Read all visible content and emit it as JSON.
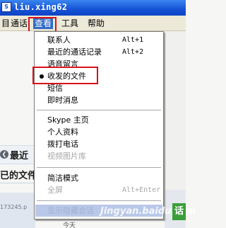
{
  "window": {
    "title": "liu.xing62"
  },
  "menubar": {
    "items": [
      "目",
      "通话",
      "查看",
      "工具",
      "帮助"
    ],
    "active_index": 2
  },
  "background": {
    "back_icon": "back-arrow-icon",
    "recent_heading": "最近",
    "files_heading": "已的文件",
    "contact_id": "173245.p",
    "date_label": "今天"
  },
  "view_menu": {
    "items": [
      {
        "label": "联系人",
        "shortcut": "Alt+1",
        "state": "normal"
      },
      {
        "label": "最近的通话记录",
        "shortcut": "Alt+2",
        "state": "normal"
      },
      {
        "label": "语音留言",
        "shortcut": "",
        "state": "normal"
      },
      {
        "label": "收发的文件",
        "shortcut": "",
        "state": "checked"
      },
      {
        "label": "短信",
        "shortcut": "",
        "state": "normal"
      },
      {
        "label": "即时消息",
        "shortcut": "",
        "state": "normal"
      },
      {
        "label": "Skype 主页",
        "shortcut": "",
        "state": "normal"
      },
      {
        "label": "个人资料",
        "shortcut": "",
        "state": "normal"
      },
      {
        "label": "拨打电话",
        "shortcut": "",
        "state": "normal"
      },
      {
        "label": "视频图片库",
        "shortcut": "",
        "state": "disabled"
      },
      {
        "label": "简洁模式",
        "shortcut": "",
        "state": "normal"
      },
      {
        "label": "全屏",
        "shortcut": "Alt+Enter",
        "state": "disabled"
      },
      {
        "label": "显示隐藏会话",
        "shortcut": "",
        "state": "highlighted-disabled"
      }
    ]
  },
  "watermark": {
    "text": "Jingyan.baidu.com",
    "badge": "话"
  },
  "colors": {
    "titlebar": "#1552d6",
    "menubar": "#ece9d8",
    "highlight_box": "#d8121a",
    "menu_hover": "#b9c8e8"
  }
}
